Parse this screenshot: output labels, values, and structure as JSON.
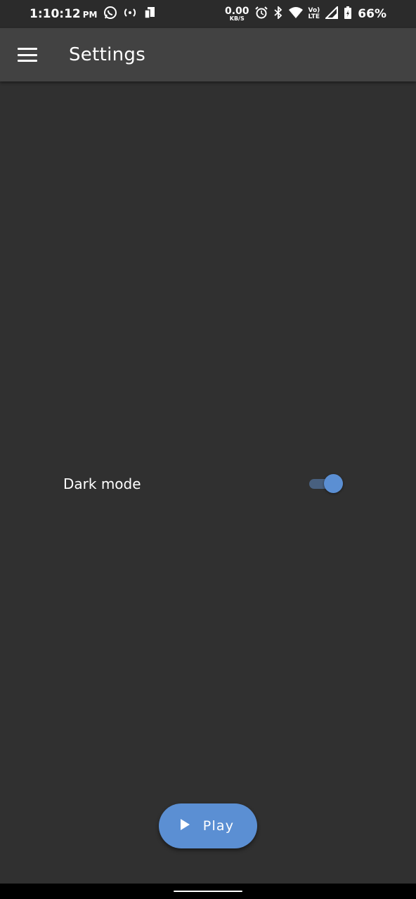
{
  "status_bar": {
    "time": "1:10:12",
    "ampm": "PM",
    "net_speed": "0.00",
    "net_speed_unit": "KB/S",
    "volte_top": "Vo)",
    "volte_bottom": "LTE",
    "battery": "66%",
    "icons": [
      "whatsapp-icon",
      "hotspot-icon",
      "device-icon",
      "alarm-icon",
      "bluetooth-icon",
      "wifi-icon",
      "signal-icon",
      "battery-icon"
    ]
  },
  "app_bar": {
    "title": "Settings",
    "menu_icon": "menu-icon"
  },
  "settings": {
    "dark_mode": {
      "label": "Dark mode",
      "enabled": true
    }
  },
  "play_button": {
    "label": "Play",
    "icon": "play-icon"
  },
  "colors": {
    "background": "#303030",
    "app_bar": "#424242",
    "accent": "#5b8fd3",
    "toggle_track": "#48607f"
  }
}
